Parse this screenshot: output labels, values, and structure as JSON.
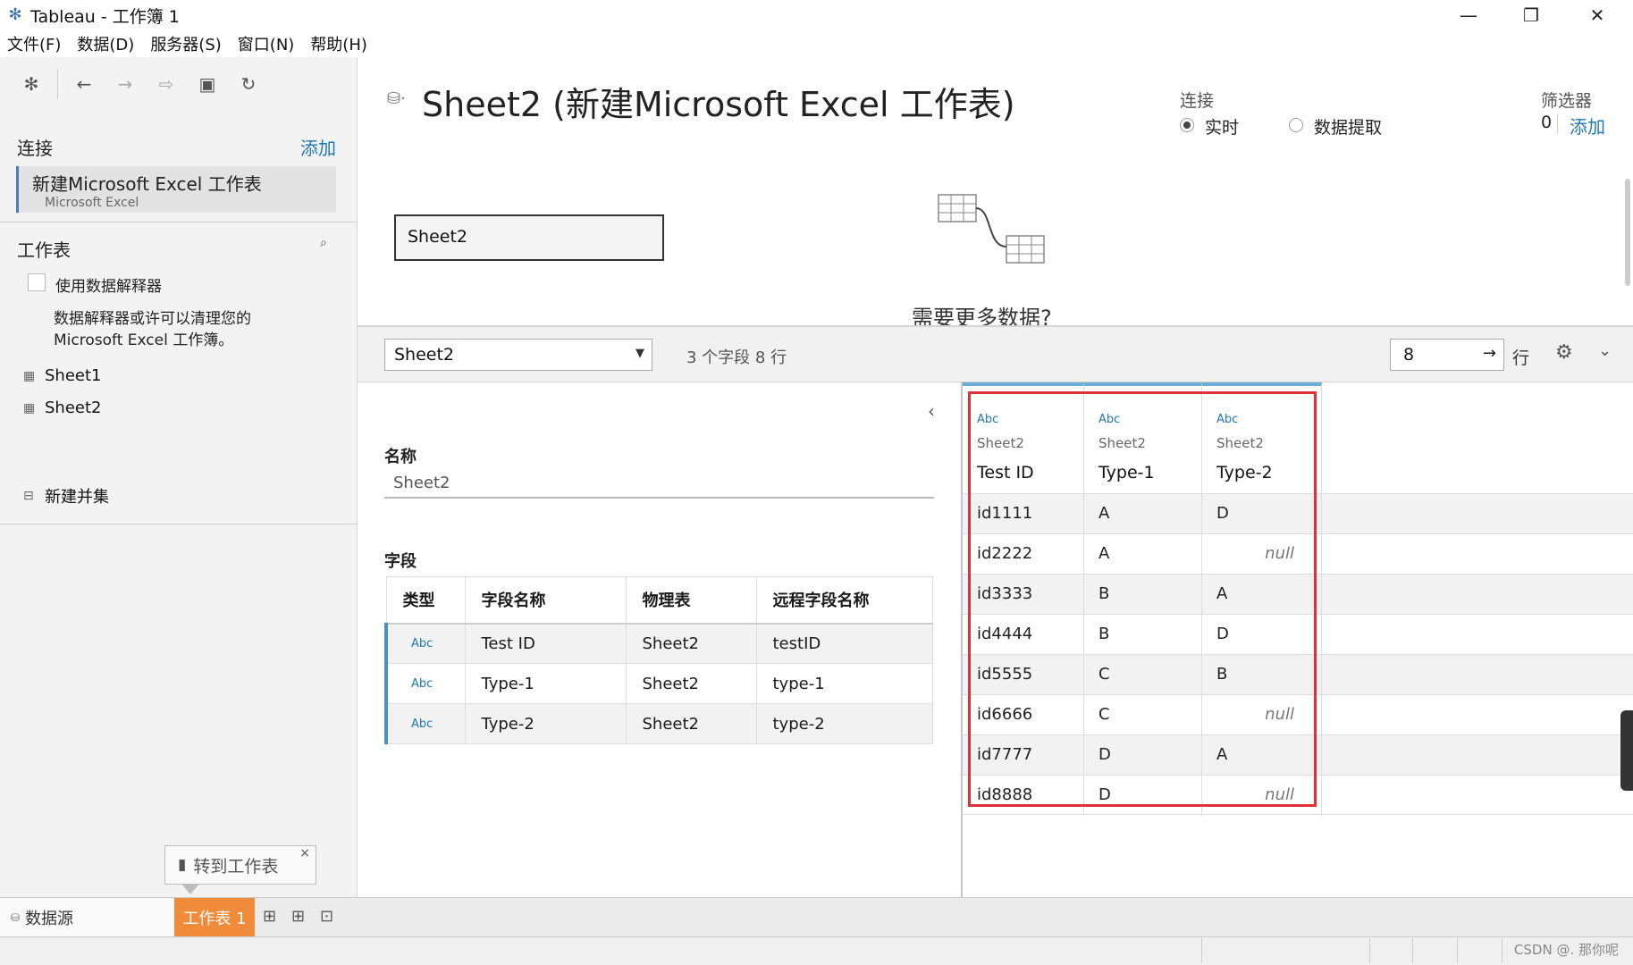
{
  "window": {
    "title": "Tableau - 工作簿 1"
  },
  "menu": [
    "文件(F)",
    "数据(D)",
    "服务器(S)",
    "窗口(N)",
    "帮助(H)"
  ],
  "left": {
    "connections_title": "连接",
    "add_link": "添加",
    "connection_name": "新建Microsoft Excel 工作表",
    "connection_type": "Microsoft Excel",
    "sheets_title": "工作表",
    "interpreter_label": "使用数据解释器",
    "interpreter_desc_1": "数据解释器或许可以清理您的",
    "interpreter_desc_2": "Microsoft Excel 工作簿。",
    "sheets": [
      "Sheet1",
      "Sheet2"
    ],
    "new_union": "新建并集",
    "tooltip": "转到工作表"
  },
  "header": {
    "title": "Sheet2 (新建Microsoft Excel 工作表)",
    "connection_label": "连接",
    "live_label": "实时",
    "extract_label": "数据提取",
    "filters_label": "筛选器",
    "filters_count": "0",
    "filters_add": "添加"
  },
  "canvas": {
    "table_name": "Sheet2",
    "more_data": "需要更多数据?"
  },
  "gridbar": {
    "selected_table": "Sheet2",
    "field_count": "3 个字段 8 行",
    "rows_value": "8",
    "rows_label": "行"
  },
  "metadata": {
    "name_label": "名称",
    "name_value": "Sheet2",
    "fields_label": "字段",
    "columns": [
      "类型",
      "字段名称",
      "物理表",
      "远程字段名称"
    ],
    "rows": [
      {
        "type": "Abc",
        "name": "Test ID",
        "table": "Sheet2",
        "remote": "testID"
      },
      {
        "type": "Abc",
        "name": "Type-1",
        "table": "Sheet2",
        "remote": "type-1"
      },
      {
        "type": "Abc",
        "name": "Type-2",
        "table": "Sheet2",
        "remote": "type-2"
      }
    ]
  },
  "grid": {
    "headers": [
      {
        "type": "Abc",
        "source": "Sheet2",
        "name": "Test ID"
      },
      {
        "type": "Abc",
        "source": "Sheet2",
        "name": "Type-1"
      },
      {
        "type": "Abc",
        "source": "Sheet2",
        "name": "Type-2"
      }
    ],
    "rows": [
      [
        "id1111",
        "A",
        "D"
      ],
      [
        "id2222",
        "A",
        "null"
      ],
      [
        "id3333",
        "B",
        "A"
      ],
      [
        "id4444",
        "B",
        "D"
      ],
      [
        "id5555",
        "C",
        "B"
      ],
      [
        "id6666",
        "C",
        "null"
      ],
      [
        "id7777",
        "D",
        "A"
      ],
      [
        "id8888",
        "D",
        "null"
      ]
    ]
  },
  "tabs": {
    "datasource": "数据源",
    "sheet": "工作表 1"
  },
  "watermark": "CSDN @. 那你呢"
}
